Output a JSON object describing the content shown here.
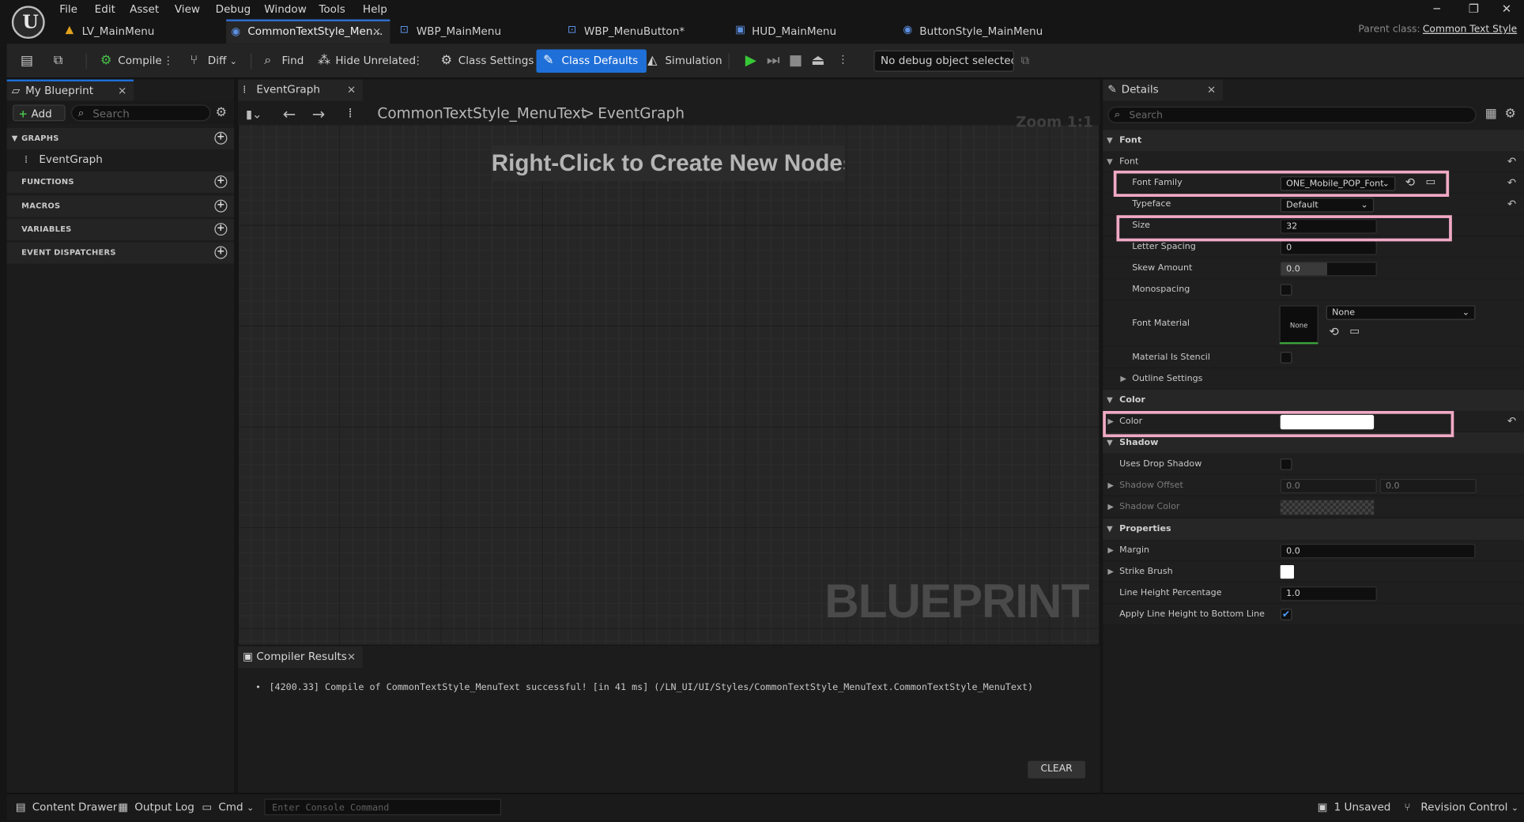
{
  "menu": [
    "File",
    "Edit",
    "Asset",
    "View",
    "Debug",
    "Window",
    "Tools",
    "Help"
  ],
  "window_controls": {
    "minimize": "─",
    "restore": "❐",
    "close": "✕"
  },
  "tabs": [
    {
      "label": "LV_MainMenu",
      "icon": "level-icon"
    },
    {
      "label": "CommonTextStyle_Men...",
      "icon": "blueprint-icon",
      "close": "×"
    },
    {
      "label": "WBP_MainMenu",
      "icon": "widget-blueprint-icon"
    },
    {
      "label": "WBP_MenuButton*",
      "icon": "widget-blueprint-icon"
    },
    {
      "label": "HUD_MainMenu",
      "icon": "blueprint-icon"
    },
    {
      "label": "ButtonStyle_MainMenu",
      "icon": "blueprint-icon"
    }
  ],
  "parent_class": {
    "label": "Parent class:",
    "value": "Common Text Style"
  },
  "toolbar": {
    "compile": "Compile",
    "diff": "Diff",
    "find": "Find",
    "hide_unrelated": "Hide Unrelated",
    "class_settings": "Class Settings",
    "class_defaults": "Class Defaults",
    "simulation": "Simulation",
    "debug_object": "No debug object selected"
  },
  "my_blueprint": {
    "tab": "My Blueprint",
    "add": "Add",
    "search_placeholder": "Search",
    "sections": {
      "graphs": "GRAPHS",
      "functions": "FUNCTIONS",
      "macros": "MACROS",
      "variables": "VARIABLES",
      "dispatchers": "EVENT DISPATCHERS"
    },
    "graph_item": "EventGraph"
  },
  "graph": {
    "tab": "EventGraph",
    "breadcrumb_root": "CommonTextStyle_MenuText",
    "breadcrumb_sep": ">",
    "breadcrumb_leaf": "EventGraph",
    "zoom": "Zoom 1:1",
    "hint": "Right-Click to Create New Nodes.",
    "watermark": "BLUEPRINT"
  },
  "compiler": {
    "tab": "Compiler Results",
    "message": "[4200.33] Compile of CommonTextStyle_MenuText successful! [in 41 ms] (/LN_UI/UI/Styles/CommonTextStyle_MenuText.CommonTextStyle_MenuText)",
    "clear": "CLEAR"
  },
  "details": {
    "tab": "Details",
    "search_placeholder": "Search",
    "sections": {
      "font": "Font",
      "color": "Color",
      "shadow": "Shadow",
      "properties": "Properties"
    },
    "font_group": "Font",
    "font_family": {
      "label": "Font Family",
      "value": "ONE_Mobile_POP_Font"
    },
    "typeface": {
      "label": "Typeface",
      "value": "Default"
    },
    "size": {
      "label": "Size",
      "value": "32"
    },
    "letter_spacing": {
      "label": "Letter Spacing",
      "value": "0"
    },
    "skew_amount": {
      "label": "Skew Amount",
      "value": "0.0"
    },
    "monospacing": {
      "label": "Monospacing"
    },
    "font_material": {
      "label": "Font Material",
      "thumb": "None",
      "value": "None"
    },
    "material_stencil": {
      "label": "Material Is Stencil"
    },
    "outline": {
      "label": "Outline Settings"
    },
    "color": {
      "label": "Color",
      "value_color": "#ffffff"
    },
    "uses_drop_shadow": {
      "label": "Uses Drop Shadow"
    },
    "shadow_offset": {
      "label": "Shadow Offset",
      "x": "0.0",
      "y": "0.0"
    },
    "shadow_color": {
      "label": "Shadow Color"
    },
    "margin": {
      "label": "Margin",
      "value": "0.0"
    },
    "strike_brush": {
      "label": "Strike Brush"
    },
    "line_height": {
      "label": "Line Height Percentage",
      "value": "1.0"
    },
    "apply_line_height": {
      "label": "Apply Line Height to Bottom Line",
      "checked": true
    }
  },
  "statusbar": {
    "content_drawer": "Content Drawer",
    "output_log": "Output Log",
    "cmd": "Cmd",
    "console_placeholder": "Enter Console Command",
    "unsaved": "1 Unsaved",
    "revision": "Revision Control"
  },
  "colors": {
    "accent": "#1f6fd8",
    "highlight": "#f0a9c5",
    "play": "#37c837"
  }
}
